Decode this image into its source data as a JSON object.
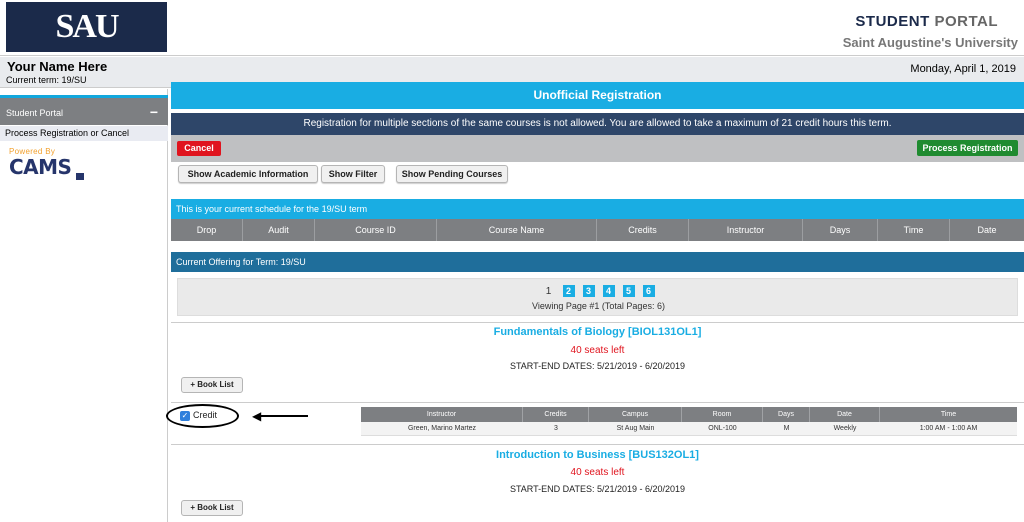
{
  "header": {
    "logo_text": "SAU",
    "portal_title_strong": "STUDENT",
    "portal_title_rest": "PORTAL",
    "university": "Saint Augustine's University"
  },
  "user": {
    "name": "Your Name Here",
    "current_term": "Current term: 19/SU",
    "date": "Monday, April 1, 2019"
  },
  "sidebar": {
    "section_label": "Student Portal",
    "collapse_symbol": "−",
    "item": "Process Registration or Cancel",
    "powered_by": "Powered By",
    "cams": "CAMS"
  },
  "main": {
    "title": "Unofficial Registration",
    "notice": "Registration for multiple sections of the same courses is not allowed.  You are allowed to take a maximum of 21 credit hours this term.",
    "cancel_label": "Cancel",
    "process_label": "Process Registration",
    "show_academic": "Show Academic Information",
    "show_filter": "Show Filter",
    "show_pending": "Show Pending Courses",
    "schedule_header": "This is your current schedule for the 19/SU term",
    "schedule_columns": [
      "Drop",
      "Audit",
      "Course ID",
      "Course Name",
      "Credits",
      "Instructor",
      "Days",
      "Time",
      "Date"
    ],
    "offering_header": "Current Offering for Term: 19/SU",
    "pages": [
      "1",
      "2",
      "3",
      "4",
      "5",
      "6"
    ],
    "viewing": "Viewing Page #1 (Total Pages: 6)"
  },
  "courses": [
    {
      "title": "Fundamentals of Biology [BIOL131OL1]",
      "seats": "40 seats left",
      "dates": "START-END DATES: 5/21/2019 - 6/20/2019",
      "book_label": "+ Book List"
    },
    {
      "title": "Introduction to Business [BUS132OL1]",
      "seats": "40 seats left",
      "dates": "START-END DATES: 5/21/2019 - 6/20/2019",
      "book_label": "+ Book List"
    }
  ],
  "credit_option": {
    "label": "Credit",
    "checked": true
  },
  "section_table": {
    "columns": [
      "Instructor",
      "Credits",
      "Campus",
      "Room",
      "Days",
      "Date",
      "Time"
    ],
    "row": [
      "Green, Marino Martez",
      "3",
      "St Aug Main",
      "ONL-100",
      "M",
      "Weekly",
      "1:00 AM - 1:00 AM"
    ]
  },
  "colors": {
    "accent_blue": "#19ade3",
    "navy": "#2e4669",
    "cancel_red": "#e0141e",
    "process_green": "#1f8b30",
    "seats_red": "#e0141e"
  }
}
